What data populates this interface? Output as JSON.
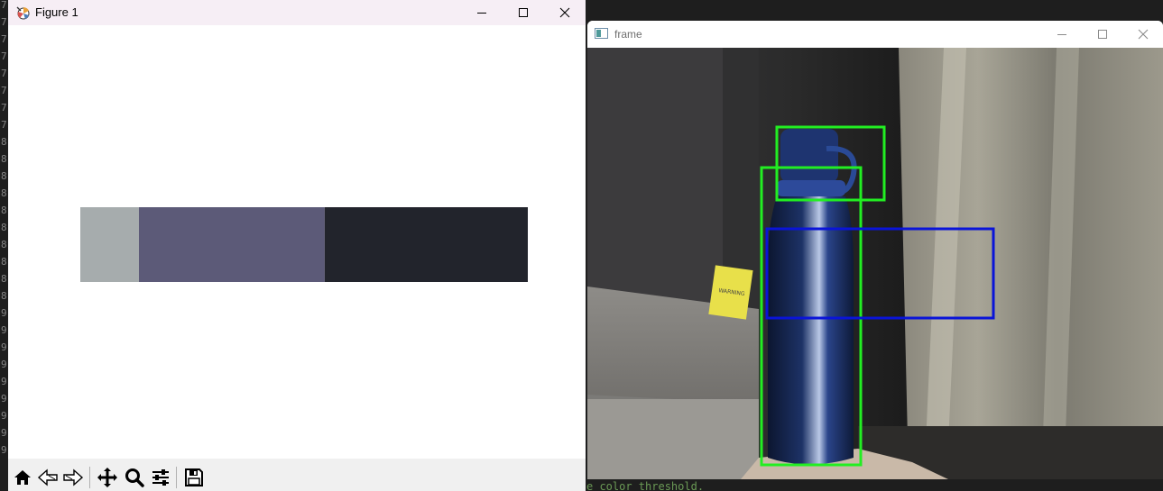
{
  "editor": {
    "line_numbers": [
      "7",
      "7",
      "7",
      "7",
      "7",
      "7",
      "7",
      "7",
      "8",
      "8",
      "8",
      "8",
      "8",
      "8",
      "8",
      "8",
      "8",
      "8",
      "9",
      "9",
      "9",
      "9",
      "9",
      "9",
      "9",
      "9",
      "9"
    ],
    "status_text": "e color threshold."
  },
  "figure_window": {
    "title": "Figure 1",
    "app_icon": "matplotlib-icon",
    "controls": [
      "minimize-icon",
      "maximize-icon",
      "close-icon"
    ],
    "toolbar": [
      "home-icon",
      "back-arrow-icon",
      "forward-arrow-icon",
      "pan-move-icon",
      "zoom-magnifier-icon",
      "configure-subplots-icon",
      "save-floppy-icon"
    ],
    "color_bar": {
      "segments": [
        {
          "color": "#a6acad",
          "fraction": 0.131
        },
        {
          "color": "#5c5a78",
          "fraction": 0.415
        },
        {
          "color": "#22242c",
          "fraction": 0.454
        }
      ]
    }
  },
  "frame_window": {
    "title": "frame",
    "icon": "image-window-icon",
    "controls": [
      "minimize-icon",
      "maximize-icon",
      "close-icon"
    ],
    "detections": [
      {
        "color": "#22ee22",
        "label": "bottle-cap-box"
      },
      {
        "color": "#22ee22",
        "label": "bottle-body-box"
      },
      {
        "color": "#0a14d8",
        "label": "blue-region-box"
      }
    ],
    "warning_tag_text": "WARNING"
  }
}
